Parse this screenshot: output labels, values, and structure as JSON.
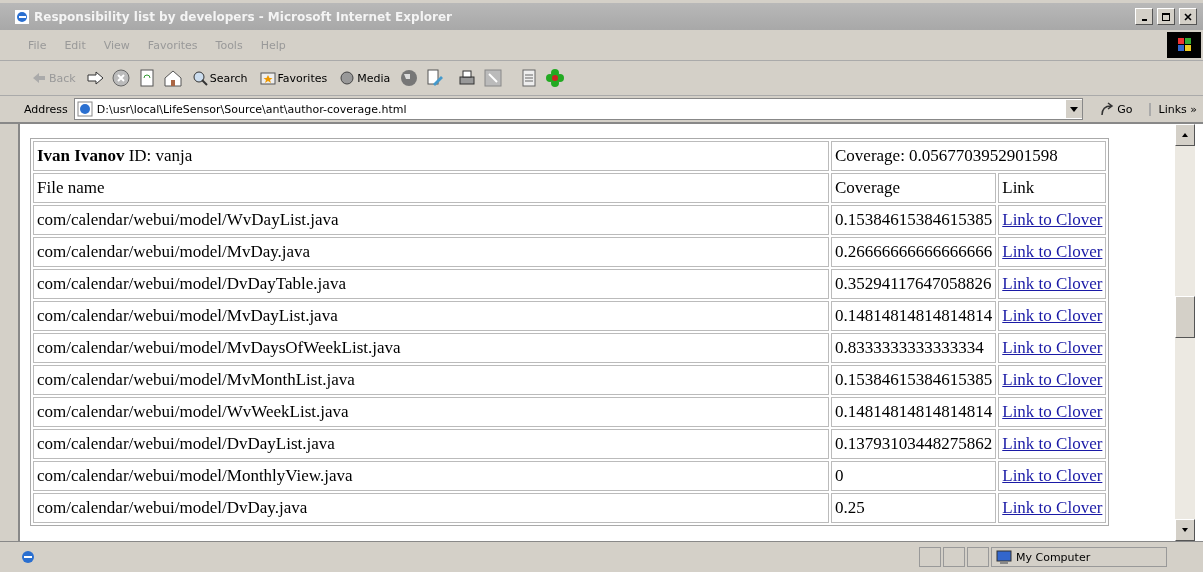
{
  "window": {
    "title": "Responsibility list by developers - Microsoft Internet Explorer"
  },
  "menu": [
    "File",
    "Edit",
    "View",
    "Favorites",
    "Tools",
    "Help"
  ],
  "toolbar": {
    "back": "Back",
    "search": "Search",
    "favorites": "Favorites",
    "media": "Media"
  },
  "address": {
    "label": "Address",
    "value": "D:\\usr\\local\\LifeSensor\\Source\\ant\\author-coverage.html",
    "go": "Go",
    "links": "Links »"
  },
  "table": {
    "author": "**Ivan Ivanov** ID: vanja",
    "total": "Coverage: 0.0567703952901598",
    "columns": [
      "File name",
      "Coverage",
      "Link"
    ],
    "rows": [
      {
        "file": "com/calendar/webui/model/WvDayList.java",
        "coverage": "0.15384615384615385",
        "link": "Link to Clover"
      },
      {
        "file": "com/calendar/webui/model/MvDay.java",
        "coverage": "0.26666666666666666",
        "link": "Link to Clover"
      },
      {
        "file": "com/calendar/webui/model/DvDayTable.java",
        "coverage": "0.35294117647058826",
        "link": "Link to Clover"
      },
      {
        "file": "com/calendar/webui/model/MvDayList.java",
        "coverage": "0.14814814814814814",
        "link": "Link to Clover"
      },
      {
        "file": "com/calendar/webui/model/MvDaysOfWeekList.java",
        "coverage": "0.8333333333333334",
        "link": "Link to Clover"
      },
      {
        "file": "com/calendar/webui/model/MvMonthList.java",
        "coverage": "0.15384615384615385",
        "link": "Link to Clover"
      },
      {
        "file": "com/calendar/webui/model/WvWeekList.java",
        "coverage": "0.14814814814814814",
        "link": "Link to Clover"
      },
      {
        "file": "com/calendar/webui/model/DvDayList.java",
        "coverage": "0.13793103448275862",
        "link": "Link to Clover"
      },
      {
        "file": "com/calendar/webui/model/MonthlyView.java",
        "coverage": "0",
        "link": "Link to Clover"
      },
      {
        "file": "com/calendar/webui/model/DvDay.java",
        "coverage": "0.25",
        "link": "Link to Clover"
      }
    ]
  },
  "status_bar": {
    "zone": "My Computer"
  }
}
